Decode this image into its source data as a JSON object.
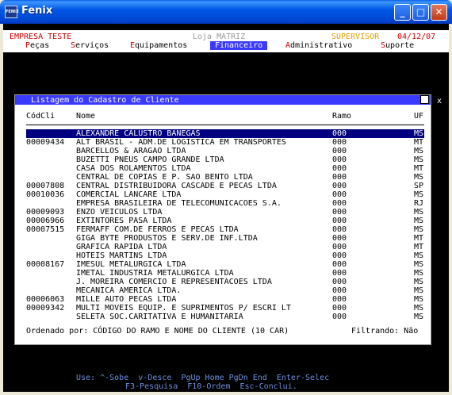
{
  "window": {
    "title": "Fenix",
    "icon": "fenix-app-icon",
    "icon_text": "FENIX"
  },
  "header": {
    "company": "EMPRESA TESTE",
    "store": "Loja MATRIZ",
    "role": "SUPERVISOR",
    "date": "04/12/07"
  },
  "menu": {
    "items": [
      {
        "hotkey": "P",
        "rest": "eças"
      },
      {
        "hotkey": "S",
        "rest": "erviços"
      },
      {
        "hotkey": "E",
        "rest": "quipamentos"
      },
      {
        "hotkey": "",
        "rest": "Financeiro",
        "active": true
      },
      {
        "hotkey": "A",
        "rest": "dministrativo"
      },
      {
        "hotkey": "S",
        "rest": "uporte"
      }
    ]
  },
  "dialog": {
    "title": "Listagem do Cadastro de Cliente",
    "close": "x",
    "columns": {
      "code": "CódCli",
      "name": "Nome",
      "branch": "Ramo",
      "state": "UF"
    },
    "rows": [
      {
        "code": "",
        "name": "ALEXANDRE CALUSTRO BANEGAS",
        "branch": "000",
        "state": "MS"
      },
      {
        "code": "00009434",
        "name": "ALT BRASIL - ADM.DE LOGISTICA EM TRANSPORTES",
        "branch": "000",
        "state": "MT"
      },
      {
        "code": "",
        "name": "BARCELLOS & ARAGAO LTDA",
        "branch": "000",
        "state": "MS"
      },
      {
        "code": "",
        "name": "BUZETTI PNEUS CAMPO GRANDE LTDA",
        "branch": "000",
        "state": "MS"
      },
      {
        "code": "",
        "name": "CASA DOS ROLAMENTOS LTDA",
        "branch": "000",
        "state": "MT"
      },
      {
        "code": "",
        "name": "CENTRAL DE COPIAS E P. SAO BENTO LTDA",
        "branch": "000",
        "state": "MS"
      },
      {
        "code": "00007808",
        "name": "CENTRAL DISTRIBUIDORA CASCADE E PECAS LTDA",
        "branch": "000",
        "state": "SP"
      },
      {
        "code": "00010036",
        "name": "COMERCIAL LANCARE LTDA",
        "branch": "000",
        "state": "MS"
      },
      {
        "code": "",
        "name": "EMPRESA BRASILEIRA DE TELECOMUNICACOES S.A.",
        "branch": "000",
        "state": "RJ"
      },
      {
        "code": "00009093",
        "name": "ENZO VEICULOS LTDA",
        "branch": "000",
        "state": "MS"
      },
      {
        "code": "00006966",
        "name": "EXTINTORES PASA LTDA",
        "branch": "000",
        "state": "MS"
      },
      {
        "code": "00007515",
        "name": "FERMAFF COM.DE FERROS E PECAS LTDA",
        "branch": "000",
        "state": "MS"
      },
      {
        "code": "",
        "name": "GIGA BYTE PRODUSTOS E SERV.DE INF.LTDA",
        "branch": "000",
        "state": "MT"
      },
      {
        "code": "",
        "name": "GRAFICA RAPIDA LTDA",
        "branch": "000",
        "state": "MT"
      },
      {
        "code": "",
        "name": "HOTEIS MARTINS LTDA",
        "branch": "000",
        "state": "MS"
      },
      {
        "code": "00008167",
        "name": "IMESUL METALURGICA LTDA",
        "branch": "000",
        "state": "MS"
      },
      {
        "code": "",
        "name": "IMETAL INDUSTRIA METALURGICA LTDA",
        "branch": "000",
        "state": "MS"
      },
      {
        "code": "",
        "name": "J. MOREIRA COMERCIO E REPRESENTACOES LTDA",
        "branch": "000",
        "state": "MS"
      },
      {
        "code": "",
        "name": "MECANICA AMERICA LTDA.",
        "branch": "000",
        "state": "MS"
      },
      {
        "code": "00006063",
        "name": "MILLE AUTO PECAS LTDA",
        "branch": "000",
        "state": "MS"
      },
      {
        "code": "00009342",
        "name": "MULTI MOVEIS EQUIP. E SUPRIMENTOS P/ ESCRI LT",
        "branch": "000",
        "state": "MS"
      },
      {
        "code": "",
        "name": "SELETA SOC.CARITATIVA E HUMANITARIA",
        "branch": "000",
        "state": "MS"
      }
    ],
    "footer": {
      "order": "Ordenado por: CÓDIGO DO RAMO E NOME DO CLIENTE (10 CAR)",
      "filter": "Filtrando: Não"
    }
  },
  "help": {
    "line1": "Use: ^-Sobe  v-Desce  PgUp Home PgDn End  Enter-Selec",
    "line2": "F3-Pesquisa  F10-Ordem  Esc-Conclui."
  },
  "colors": {
    "red": "#cc0000",
    "supervisor": "#e0a000",
    "menu_active_bg": "#3a3aff",
    "selection": "#000080",
    "help": "#6f8fe0"
  }
}
